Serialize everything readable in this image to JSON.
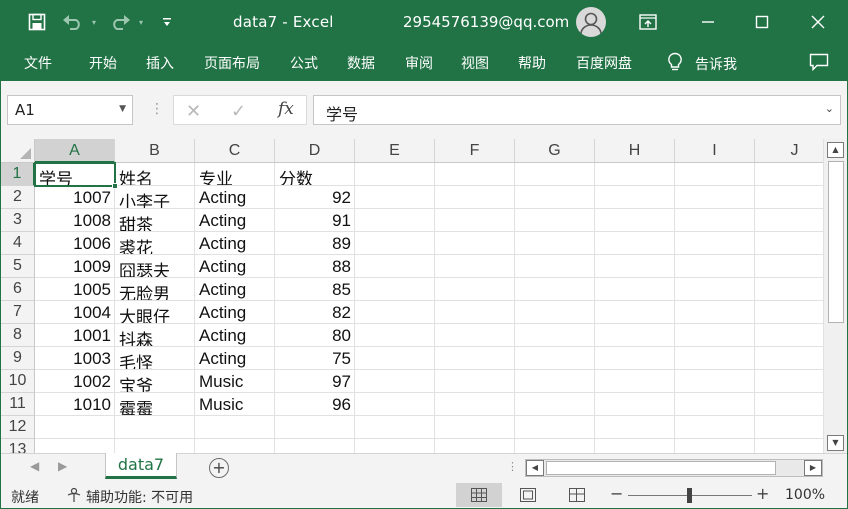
{
  "titlebar": {
    "title": "data7  -  Excel",
    "account": "2954576139@qq.com"
  },
  "ribbon": {
    "tabs": [
      "文件",
      "开始",
      "插入",
      "页面布局",
      "公式",
      "数据",
      "审阅",
      "视图",
      "帮助",
      "百度网盘"
    ],
    "tell_me": "告诉我"
  },
  "formula_bar": {
    "name_box": "A1",
    "content": "学号"
  },
  "sheet": {
    "columns": [
      "A",
      "B",
      "C",
      "D",
      "E",
      "F",
      "G",
      "H",
      "I",
      "J"
    ],
    "rows": [
      "1",
      "2",
      "3",
      "4",
      "5",
      "6",
      "7",
      "8",
      "9",
      "10",
      "11",
      "12",
      "13"
    ],
    "active_cell": "A1",
    "cells": [
      [
        "学号",
        "姓名",
        "专业",
        "分数"
      ],
      [
        "1007",
        "小李子",
        "Acting",
        "92"
      ],
      [
        "1008",
        "甜茶",
        "Acting",
        "91"
      ],
      [
        "1006",
        "裘花",
        "Acting",
        "89"
      ],
      [
        "1009",
        "囧瑟夫",
        "Acting",
        "88"
      ],
      [
        "1005",
        "无脸男",
        "Acting",
        "85"
      ],
      [
        "1004",
        "大眼仔",
        "Acting",
        "82"
      ],
      [
        "1001",
        "抖森",
        "Acting",
        "80"
      ],
      [
        "1003",
        "毛怪",
        "Acting",
        "75"
      ],
      [
        "1002",
        "宝爷",
        "Music",
        "97"
      ],
      [
        "1010",
        "霉霉",
        "Music",
        "96"
      ]
    ]
  },
  "sheet_tabs": {
    "active": "data7"
  },
  "statusbar": {
    "ready": "就绪",
    "accessibility": "辅助功能: 不可用",
    "zoom": "100%"
  },
  "colors": {
    "brand": "#217346",
    "header_bg": "#f3f3f3",
    "selected_header": "#d2d2d2"
  },
  "icons": [
    "save-icon",
    "undo-icon",
    "redo-icon",
    "customize-icon",
    "avatar-icon",
    "share-icon",
    "minimize-icon",
    "maximize-icon",
    "close-icon",
    "lightbulb-icon",
    "comment-icon",
    "cancel-icon",
    "enter-icon",
    "fx-icon",
    "add-sheet-icon",
    "accessibility-icon",
    "normal-view-icon",
    "page-layout-icon",
    "page-break-icon"
  ]
}
